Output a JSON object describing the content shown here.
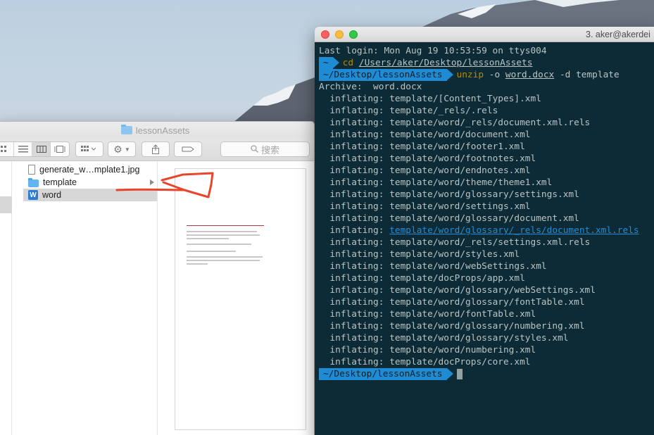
{
  "finder": {
    "title": "lessonAssets",
    "search_placeholder": "搜索",
    "files": [
      {
        "name": "generate_w…mplate1.jpg",
        "icon": "image-file-icon"
      },
      {
        "name": "template",
        "icon": "folder-icon"
      },
      {
        "name": "word",
        "icon": "word-icon",
        "selected": true
      }
    ]
  },
  "terminal": {
    "title": "3. aker@akerdei",
    "last_login": "Last login: Mon Aug 19 10:53:59 on ttys004",
    "prompt_home": "~",
    "cd_cmd": "cd",
    "cd_path": "/Users/aker/Desktop/lessonAssets",
    "prompt_dir": "~/Desktop/lessonAssets",
    "unzip_cmd": "unzip",
    "unzip_flag": "-o",
    "unzip_file": "word.docx",
    "unzip_rest": "-d template",
    "archive_line": "Archive:  word.docx",
    "inflating_label": "inflating:",
    "inflated": [
      "template/[Content_Types].xml",
      "template/_rels/.rels",
      "template/word/_rels/document.xml.rels",
      "template/word/document.xml",
      "template/word/footer1.xml",
      "template/word/footnotes.xml",
      "template/word/endnotes.xml",
      "template/word/theme/theme1.xml",
      "template/word/glossary/settings.xml",
      "template/word/settings.xml",
      "template/word/glossary/document.xml",
      "template/word/glossary/_rels/document.xml.rels",
      "template/word/_rels/settings.xml.rels",
      "template/word/styles.xml",
      "template/word/webSettings.xml",
      "template/docProps/app.xml",
      "template/word/glossary/webSettings.xml",
      "template/word/glossary/fontTable.xml",
      "template/word/fontTable.xml",
      "template/word/glossary/numbering.xml",
      "template/word/glossary/styles.xml",
      "template/word/numbering.xml",
      "template/docProps/core.xml"
    ],
    "highlighted_index": 11,
    "final_prompt": "~/Desktop/lessonAssets"
  },
  "colors": {
    "terminal_bg": "#0c2b36",
    "prompt_blue": "#1e8bd4",
    "command_yellow": "#b58900",
    "link_blue": "#268bd2",
    "annotation_red": "#e8452c"
  }
}
